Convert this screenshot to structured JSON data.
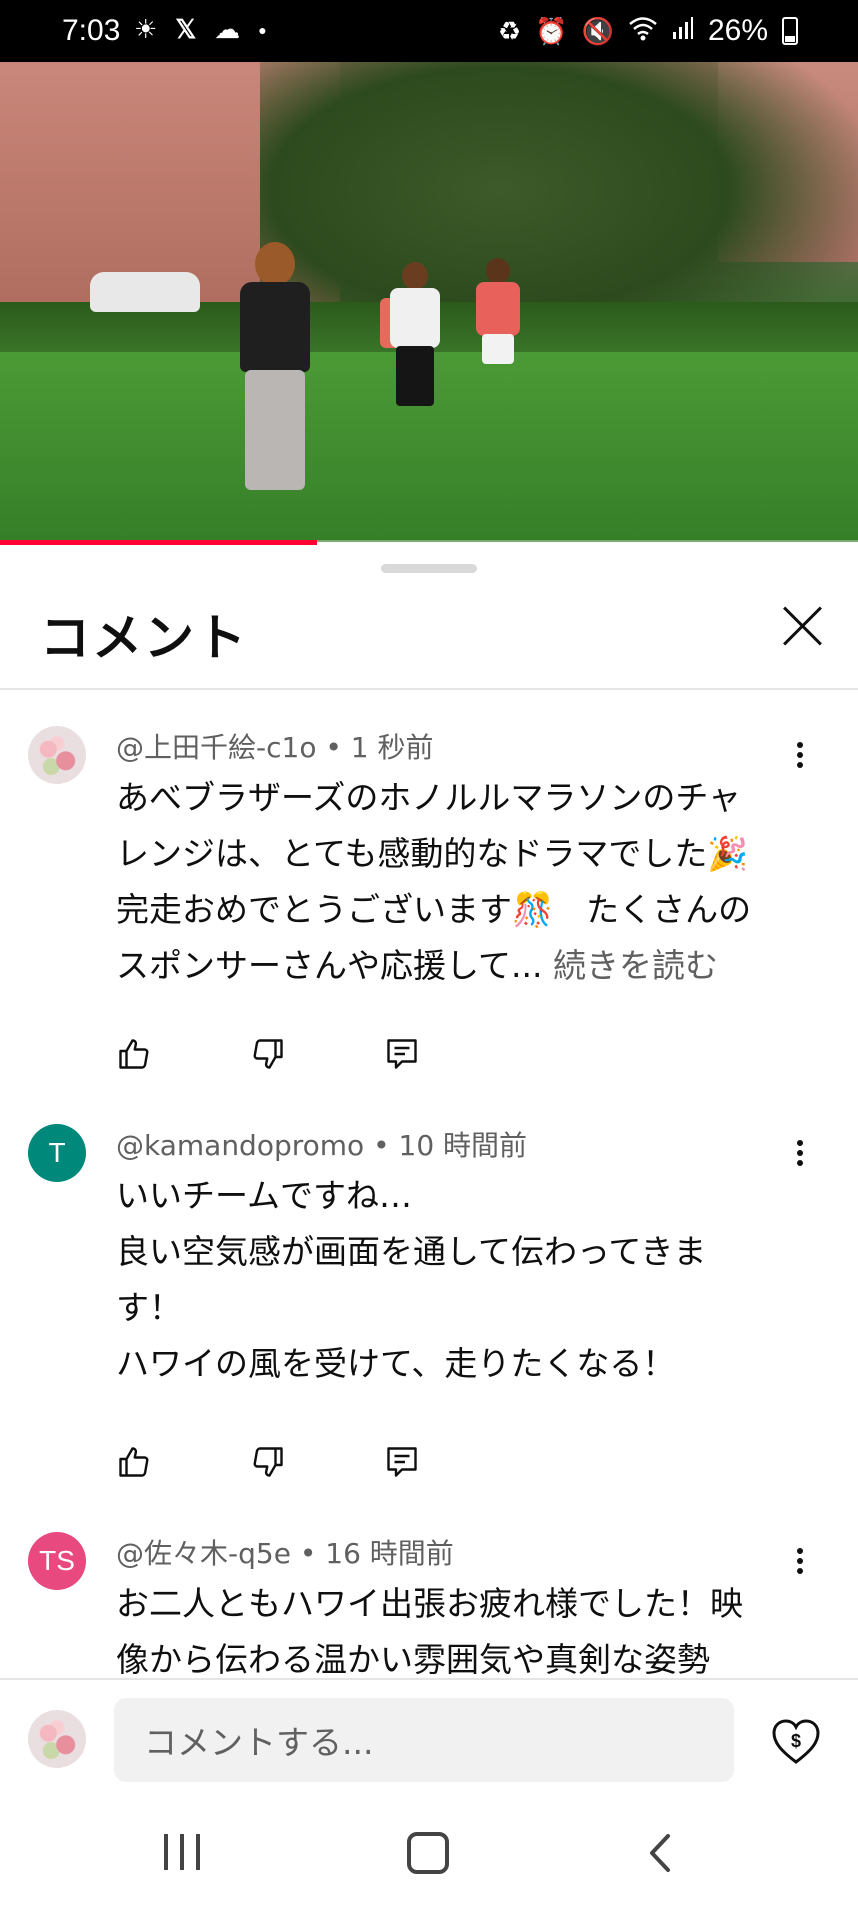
{
  "status_bar": {
    "time": "7:03",
    "battery": "26%",
    "icons": [
      "brightness-icon",
      "x-icon",
      "cloud-icon",
      "dot-icon",
      "battery-saver-icon",
      "alarm-icon",
      "mute-icon",
      "wifi-icon",
      "signal-icon",
      "battery-icon"
    ]
  },
  "video": {
    "progress_fraction": 0.37,
    "progress_color": "#ff0033"
  },
  "sheet": {
    "title": "コメント"
  },
  "comments": [
    {
      "avatar_type": "image",
      "author": "@上田千絵-c1o",
      "time": "1 秒前",
      "lines": [
        "あべブラザーズのホノルルマラソンのチャ",
        "レンジは、とても感動的なドラマでした🎉",
        "完走おめでとうございます🎊　たくさんの"
      ],
      "last_line": "スポンサーさんや応援して... ",
      "read_more": "続きを読む"
    },
    {
      "avatar_type": "letter",
      "avatar_letter": "T",
      "avatar_color": "#00897b",
      "author": "@kamandopromo",
      "time": "10 時間前",
      "lines": [
        "いいチームですね…",
        "良い空気感が画面を通して伝わってきま",
        "す！",
        "ハワイの風を受けて、走りたくなる！"
      ]
    },
    {
      "avatar_type": "letter",
      "avatar_letter": "TS",
      "avatar_color": "#e84a7f",
      "author": "@佐々木-q5e",
      "time": "16 時間前",
      "lines": [
        "お二人ともハワイ出張お疲れ様でした！映",
        "像から伝わる温かい雰囲気や真剣な姿勢"
      ]
    }
  ],
  "input": {
    "placeholder": "コメントする..."
  }
}
